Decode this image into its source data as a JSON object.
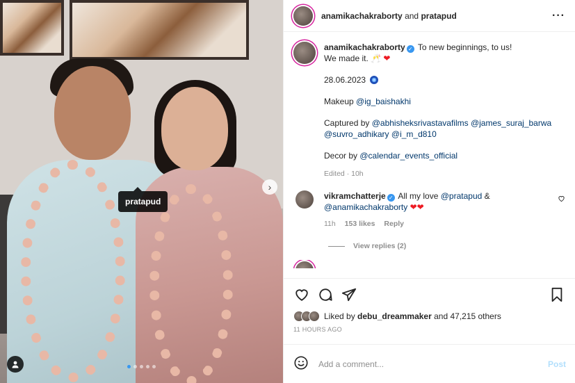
{
  "post": {
    "header": {
      "user1": "anamikachakraborty",
      "and": "and",
      "user2": "pratapud"
    },
    "photo_tag": "pratapud",
    "caption": {
      "username": "anamikachakraborty",
      "line1": "To new beginnings, to us!",
      "line2": "We made it. 🥂",
      "heart": "❤",
      "date": "28.06.2023",
      "makeup_label": "Makeup",
      "makeup_mention": "@ig_baishakhi",
      "captured_label": "Captured by",
      "captured_mentions_1": "@abhisheksrivastavafilms @james_suraj_barwa",
      "captured_mentions_2": "@suvro_adhikary @i_m_d810",
      "decor_label": "Decor by",
      "decor_mention": "@calendar_events_official",
      "edited": "Edited · 10h"
    },
    "comment": {
      "username": "vikramchatterje",
      "text_before": "All my love",
      "mention1": "@pratapud",
      "amp": "&",
      "mention2": "@anamikachakraborty",
      "hearts": "❤❤",
      "time": "11h",
      "likes": "153 likes",
      "reply": "Reply",
      "view_replies": "View replies (2)"
    },
    "likes_line": {
      "prefix": "Liked by",
      "user": "debu_dreammaker",
      "suffix": "and 47,215 others"
    },
    "timestamp": "11 HOURS AGO",
    "add_comment": {
      "placeholder": "Add a comment...",
      "post_label": "Post"
    }
  },
  "icons": {
    "more": "more-options-icon",
    "like": "heart-icon",
    "comment": "comment-icon",
    "share": "paper-plane-icon",
    "save": "bookmark-icon",
    "emoji": "emoji-icon",
    "next": "chevron-right-icon",
    "tagged": "user-tag-icon"
  },
  "colors": {
    "verified": "#3897f0",
    "mention": "#00376b",
    "post_disabled": "#b2dffc",
    "muted": "#8e8e8e"
  },
  "carousel": {
    "slides": 5,
    "active": 1
  }
}
